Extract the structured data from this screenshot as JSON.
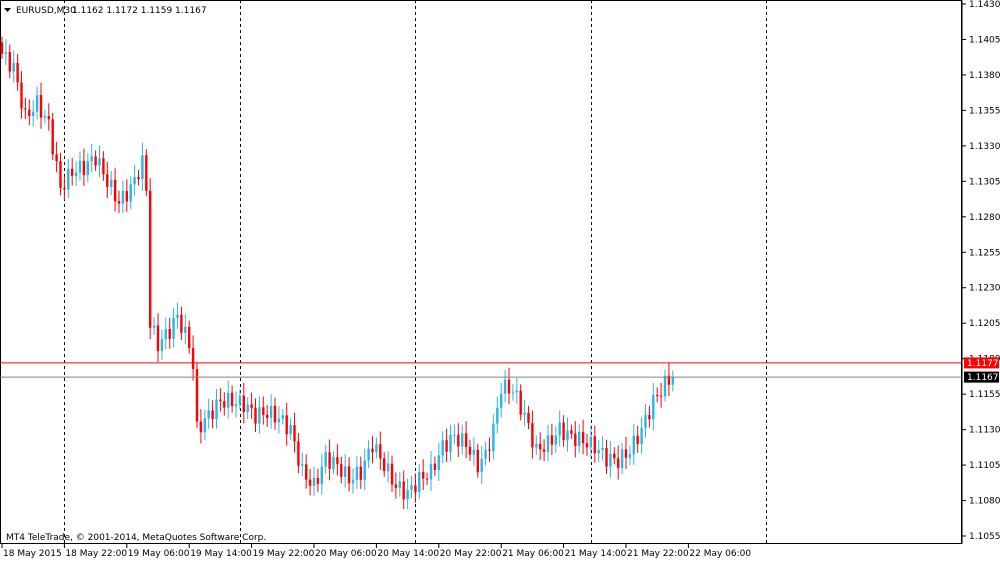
{
  "header": {
    "symbol": "EURUSD,M30",
    "ohlc": "1.1162 1.1172 1.1159 1.1167"
  },
  "copyright": "MT4 TeleTrade, © 2001-2014, MetaQuotes Software Corp.",
  "colors": {
    "bull": "#29B6E8",
    "bear": "#FF0000",
    "ask_line": "#FF0000",
    "bid_line": "#808080",
    "bid_label_bg": "#000000",
    "ask_label_bg": "#FF0000",
    "grid": "#000000"
  },
  "chart_data": {
    "type": "candlestick",
    "timeframe": "M30",
    "ylim": [
      1.1055,
      1.143
    ],
    "y_ticks": [
      "1.1430",
      "1.1405",
      "1.1380",
      "1.1355",
      "1.1330",
      "1.1305",
      "1.1280",
      "1.1255",
      "1.1230",
      "1.1205",
      "1.1180",
      "1.1155",
      "1.1130",
      "1.1105",
      "1.1080",
      "1.1055"
    ],
    "x_ticks": [
      "18 May 2015",
      "18 May 22:00",
      "19 May 06:00",
      "19 May 14:00",
      "19 May 22:00",
      "20 May 06:00",
      "20 May 14:00",
      "20 May 22:00",
      "21 May 06:00",
      "21 May 14:00",
      "21 May 22:00",
      "22 May 06:00"
    ],
    "price_labels": {
      "ask": "1.1177",
      "bid": "1.1167"
    },
    "ask_price": 1.1177,
    "bid_price": 1.1167,
    "period_separators": [
      "18 May 22:00",
      "19 May 22:00",
      "20 May 22:00",
      "21 May 22:00",
      "22 May 22:00"
    ],
    "close_path": [
      [
        0,
        1.1395
      ],
      [
        3,
        1.1385
      ],
      [
        6,
        1.135
      ],
      [
        9,
        1.136
      ],
      [
        12,
        1.1345
      ],
      [
        15,
        1.13
      ],
      [
        18,
        1.1312
      ],
      [
        21,
        1.1315
      ],
      [
        24,
        1.1322
      ],
      [
        27,
        1.1305
      ],
      [
        30,
        1.129
      ],
      [
        33,
        1.13
      ],
      [
        36,
        1.1318
      ],
      [
        37,
        1.13
      ],
      [
        38,
        1.1205
      ],
      [
        40,
        1.119
      ],
      [
        43,
        1.12
      ],
      [
        45,
        1.121
      ],
      [
        48,
        1.119
      ],
      [
        49,
        1.1175
      ],
      [
        50,
        1.113
      ],
      [
        53,
        1.114
      ],
      [
        56,
        1.115
      ],
      [
        59,
        1.115
      ],
      [
        62,
        1.1148
      ],
      [
        65,
        1.114
      ],
      [
        68,
        1.1142
      ],
      [
        71,
        1.1138
      ],
      [
        74,
        1.113
      ],
      [
        77,
        1.11
      ],
      [
        80,
        1.109
      ],
      [
        83,
        1.111
      ],
      [
        86,
        1.1105
      ],
      [
        89,
        1.1095
      ],
      [
        92,
        1.11
      ],
      [
        95,
        1.112
      ],
      [
        98,
        1.1105
      ],
      [
        101,
        1.109
      ],
      [
        104,
        1.1085
      ],
      [
        107,
        1.1095
      ],
      [
        110,
        1.11
      ],
      [
        113,
        1.1118
      ],
      [
        116,
        1.1125
      ],
      [
        119,
        1.112
      ],
      [
        122,
        1.1105
      ],
      [
        124,
        1.1112
      ],
      [
        126,
        1.113
      ],
      [
        128,
        1.116
      ],
      [
        131,
        1.1158
      ],
      [
        134,
        1.114
      ],
      [
        137,
        1.1115
      ],
      [
        140,
        1.112
      ],
      [
        143,
        1.113
      ],
      [
        146,
        1.1125
      ],
      [
        149,
        1.1122
      ],
      [
        152,
        1.1118
      ],
      [
        155,
        1.111
      ],
      [
        158,
        1.1108
      ],
      [
        161,
        1.1115
      ],
      [
        164,
        1.113
      ],
      [
        167,
        1.115
      ],
      [
        170,
        1.1162
      ],
      [
        172,
        1.1168
      ]
    ]
  }
}
